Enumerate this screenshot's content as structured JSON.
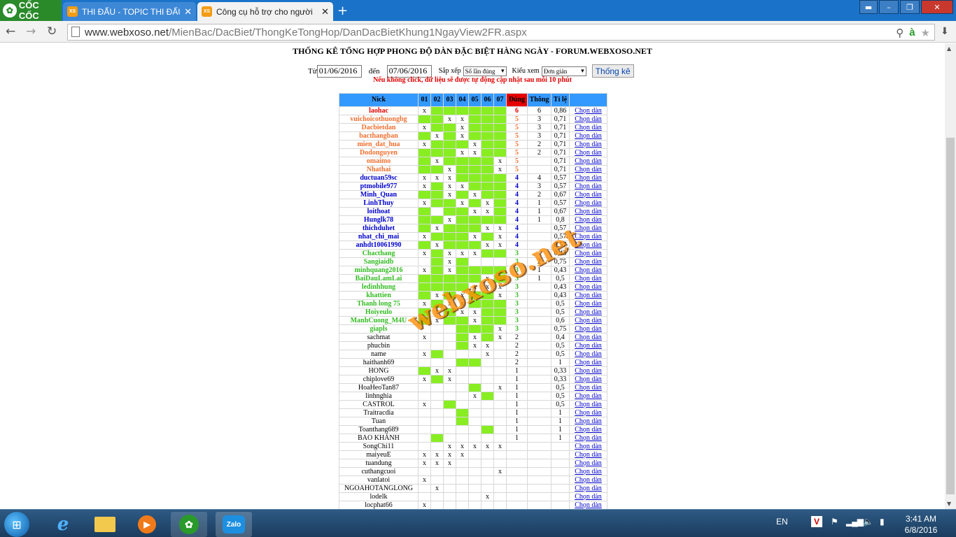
{
  "browser": {
    "logo": "CỐC CỐC",
    "tabs": [
      {
        "label": "THI ĐẤU - TOPIC THI ĐẤU",
        "icon": "XS"
      },
      {
        "label": "Công cụ hỗ trợ cho người",
        "icon": "XS"
      }
    ],
    "url_host": "www.webxoso.net",
    "url_path": "/MienBac/DacBiet/ThongKeTongHop/DanDacBietKhung1NgayView2FR.aspx"
  },
  "page": {
    "title": "THỐNG KÊ TỔNG HỢP PHONG ĐỘ DÀN ĐẶC BIỆT HÀNG NGÀY - FORUM.WEBXOSO.NET",
    "from_label": "Từ",
    "from_value": "01/06/2016",
    "to_label": "đến",
    "to_value": "07/06/2016",
    "sort_label": "Sắp xếp",
    "sort_value": "Số lần đúng",
    "view_label": "Kiểu xem",
    "view_value": "Đơn giản",
    "submit_label": "Thống kê",
    "note": "Nếu không click, dữ liệu sẽ được tự động cập nhật sau mỗi 10 phút",
    "watermark": "webxoso.net"
  },
  "table": {
    "headers": [
      "Nick",
      "01",
      "02",
      "03",
      "04",
      "05",
      "06",
      "07",
      "Đúng",
      "Thông",
      "Tỉ lệ",
      ""
    ],
    "link_text": "Chọn dàn",
    "colors": {
      "red": "#e00000",
      "orange": "#f07030",
      "blue": "#0000cc",
      "green": "#33bb22",
      "black": "#000000"
    },
    "rows": [
      {
        "nick": "laohac",
        "color": "red",
        "cells": [
          "x",
          "g",
          "g",
          "g",
          "g",
          "g",
          "g"
        ],
        "dung": "6",
        "thong": "6",
        "ratio": "0,86"
      },
      {
        "nick": "vuichoicothuongbg",
        "color": "orange",
        "cells": [
          "g",
          "g",
          "x",
          "x",
          "g",
          "g",
          "g"
        ],
        "dung": "5",
        "thong": "3",
        "ratio": "0,71"
      },
      {
        "nick": "Dacbietdan",
        "color": "orange",
        "cells": [
          "x",
          "g",
          "g",
          "x",
          "g",
          "g",
          "g"
        ],
        "dung": "5",
        "thong": "3",
        "ratio": "0,71"
      },
      {
        "nick": "bacthangban",
        "color": "orange",
        "cells": [
          "g",
          "x",
          "g",
          "x",
          "g",
          "g",
          "g"
        ],
        "dung": "5",
        "thong": "3",
        "ratio": "0,71"
      },
      {
        "nick": "mien_dat_hua",
        "color": "orange",
        "cells": [
          "x",
          "g",
          "g",
          "g",
          "x",
          "g",
          "g"
        ],
        "dung": "5",
        "thong": "2",
        "ratio": "0,71"
      },
      {
        "nick": "Dodonguyen",
        "color": "orange",
        "cells": [
          "g",
          "g",
          "g",
          "x",
          "x",
          "g",
          "g"
        ],
        "dung": "5",
        "thong": "2",
        "ratio": "0,71"
      },
      {
        "nick": "omaimo",
        "color": "orange",
        "cells": [
          "g",
          "x",
          "g",
          "g",
          "g",
          "g",
          "x"
        ],
        "dung": "5",
        "thong": "",
        "ratio": "0,71"
      },
      {
        "nick": "Nhathai",
        "color": "orange",
        "cells": [
          "g",
          "g",
          "x",
          "g",
          "g",
          "g",
          "x"
        ],
        "dung": "5",
        "thong": "",
        "ratio": "0,71"
      },
      {
        "nick": "ductuan59sc",
        "color": "blue",
        "cells": [
          "x",
          "x",
          "x",
          "g",
          "g",
          "g",
          "g"
        ],
        "dung": "4",
        "thong": "4",
        "ratio": "0,57"
      },
      {
        "nick": "ptmobile977",
        "color": "blue",
        "cells": [
          "x",
          "g",
          "x",
          "x",
          "g",
          "g",
          "g"
        ],
        "dung": "4",
        "thong": "3",
        "ratio": "0,57"
      },
      {
        "nick": "Minh_Quan",
        "color": "blue",
        "cells": [
          "g",
          "g",
          "x",
          "g",
          "x",
          "g",
          "g"
        ],
        "dung": "4",
        "thong": "2",
        "ratio": "0,67"
      },
      {
        "nick": "LinhThuy",
        "color": "blue",
        "cells": [
          "x",
          "g",
          "g",
          "x",
          "g",
          "x",
          "g"
        ],
        "dung": "4",
        "thong": "1",
        "ratio": "0,57"
      },
      {
        "nick": "loithoat",
        "color": "blue",
        "cells": [
          "g",
          "",
          "g",
          "g",
          "x",
          "x",
          "g"
        ],
        "dung": "4",
        "thong": "1",
        "ratio": "0,67"
      },
      {
        "nick": "Hunglk78",
        "color": "blue",
        "cells": [
          "g",
          "g",
          "x",
          "g",
          "g",
          "g",
          "g"
        ],
        "dung": "4",
        "thong": "1",
        "ratio": "0,8"
      },
      {
        "nick": "thichduhet",
        "color": "blue",
        "cells": [
          "g",
          "x",
          "g",
          "g",
          "g",
          "x",
          "x"
        ],
        "dung": "4",
        "thong": "",
        "ratio": "0,57"
      },
      {
        "nick": "nhat_chi_mai",
        "color": "blue",
        "cells": [
          "x",
          "g",
          "g",
          "g",
          "x",
          "g",
          "x"
        ],
        "dung": "4",
        "thong": "",
        "ratio": "0,57"
      },
      {
        "nick": "anhdt10061990",
        "color": "blue",
        "cells": [
          "g",
          "x",
          "g",
          "g",
          "g",
          "x",
          "x"
        ],
        "dung": "4",
        "thong": "",
        "ratio": "0,57"
      },
      {
        "nick": "Chacthang",
        "color": "green",
        "cells": [
          "x",
          "g",
          "x",
          "x",
          "x",
          "g",
          "g"
        ],
        "dung": "3",
        "thong": "",
        "ratio": "0,43"
      },
      {
        "nick": "Sangiaidb",
        "color": "green",
        "cells": [
          "",
          "g",
          "x",
          "g",
          "",
          "",
          ""
        ],
        "dung": "3",
        "thong": "2",
        "ratio": "0,75"
      },
      {
        "nick": "minhquang2016",
        "color": "green",
        "cells": [
          "x",
          "g",
          "x",
          "g",
          "g",
          "g",
          "g"
        ],
        "dung": "3",
        "thong": "1",
        "ratio": "0,43"
      },
      {
        "nick": "BaiDauLamLai",
        "color": "green",
        "cells": [
          "g",
          "g",
          "g",
          "g",
          "g",
          "x",
          "g"
        ],
        "dung": "3",
        "thong": "1",
        "ratio": "0,5"
      },
      {
        "nick": "ledinhhung",
        "color": "green",
        "cells": [
          "g",
          "g",
          "g",
          "g",
          "x",
          "x",
          "x"
        ],
        "dung": "3",
        "thong": "",
        "ratio": "0,43"
      },
      {
        "nick": "khattien",
        "color": "green",
        "cells": [
          "g",
          "x",
          "g",
          "x",
          "g",
          "g",
          "x"
        ],
        "dung": "3",
        "thong": "",
        "ratio": "0,43"
      },
      {
        "nick": "Thanh long 75",
        "color": "green",
        "cells": [
          "x",
          "g",
          "x",
          "x",
          "g",
          "g",
          "g"
        ],
        "dung": "3",
        "thong": "",
        "ratio": "0,5"
      },
      {
        "nick": "Hoiyeulo",
        "color": "green",
        "cells": [
          "g",
          "x",
          "g",
          "x",
          "x",
          "g",
          "g"
        ],
        "dung": "3",
        "thong": "",
        "ratio": "0,5"
      },
      {
        "nick": "ManhCuong_M4U",
        "color": "green",
        "cells": [
          "g",
          "x",
          "g",
          "g",
          "x",
          "g",
          "g"
        ],
        "dung": "3",
        "thong": "",
        "ratio": "0,6"
      },
      {
        "nick": "giapls",
        "color": "green",
        "cells": [
          "",
          "",
          "",
          "g",
          "g",
          "g",
          "x"
        ],
        "dung": "3",
        "thong": "",
        "ratio": "0,75"
      },
      {
        "nick": "sachmat",
        "color": "black",
        "cells": [
          "x",
          "",
          "",
          "g",
          "x",
          "g",
          "x"
        ],
        "dung": "2",
        "thong": "",
        "ratio": "0,4"
      },
      {
        "nick": "phucbin",
        "color": "black",
        "cells": [
          "",
          "",
          "",
          "g",
          "x",
          "x",
          ""
        ],
        "dung": "2",
        "thong": "",
        "ratio": "0,5"
      },
      {
        "nick": "name",
        "color": "black",
        "cells": [
          "x",
          "g",
          "",
          "",
          "",
          "x",
          ""
        ],
        "dung": "2",
        "thong": "",
        "ratio": "0,5"
      },
      {
        "nick": "haithanh69",
        "color": "black",
        "cells": [
          "",
          "",
          "",
          "g",
          "g",
          "",
          ""
        ],
        "dung": "2",
        "thong": "",
        "ratio": "1"
      },
      {
        "nick": "HONG",
        "color": "black",
        "cells": [
          "g",
          "x",
          "x",
          "",
          "",
          "",
          ""
        ],
        "dung": "1",
        "thong": "",
        "ratio": "0,33"
      },
      {
        "nick": "chiplove69",
        "color": "black",
        "cells": [
          "x",
          "g",
          "x",
          "",
          "",
          "",
          ""
        ],
        "dung": "1",
        "thong": "",
        "ratio": "0,33"
      },
      {
        "nick": "HoaHeoTan87",
        "color": "black",
        "cells": [
          "",
          "",
          "",
          "",
          "g",
          "",
          "x"
        ],
        "dung": "1",
        "thong": "",
        "ratio": "0,5"
      },
      {
        "nick": "linhnghia",
        "color": "black",
        "cells": [
          "",
          "",
          "",
          "",
          "x",
          "g",
          ""
        ],
        "dung": "1",
        "thong": "",
        "ratio": "0,5"
      },
      {
        "nick": "CASTROL",
        "color": "black",
        "cells": [
          "x",
          "",
          "g",
          "",
          "",
          "",
          ""
        ],
        "dung": "1",
        "thong": "",
        "ratio": "0,5"
      },
      {
        "nick": "Traitracdia",
        "color": "black",
        "cells": [
          "",
          "",
          "",
          "g",
          "",
          "",
          ""
        ],
        "dung": "1",
        "thong": "",
        "ratio": "1"
      },
      {
        "nick": "Tuan",
        "color": "black",
        "cells": [
          "",
          "",
          "",
          "g",
          "",
          "",
          ""
        ],
        "dung": "1",
        "thong": "",
        "ratio": "1"
      },
      {
        "nick": "Toanthang689",
        "color": "black",
        "cells": [
          "",
          "",
          "",
          "",
          "",
          "g",
          ""
        ],
        "dung": "1",
        "thong": "",
        "ratio": "1"
      },
      {
        "nick": "BAO KHÁNH",
        "color": "black",
        "cells": [
          "",
          "g",
          "",
          "",
          "",
          "",
          ""
        ],
        "dung": "1",
        "thong": "",
        "ratio": "1"
      },
      {
        "nick": "SongChi11",
        "color": "black",
        "cells": [
          "",
          "",
          "x",
          "x",
          "x",
          "x",
          "x"
        ],
        "dung": "",
        "thong": "",
        "ratio": ""
      },
      {
        "nick": "maiyeuE",
        "color": "black",
        "cells": [
          "x",
          "x",
          "x",
          "x",
          "",
          "",
          ""
        ],
        "dung": "",
        "thong": "",
        "ratio": ""
      },
      {
        "nick": "tuandung",
        "color": "black",
        "cells": [
          "x",
          "x",
          "x",
          "",
          "",
          "",
          ""
        ],
        "dung": "",
        "thong": "",
        "ratio": ""
      },
      {
        "nick": "cuthangcuoi",
        "color": "black",
        "cells": [
          "",
          "",
          "",
          "",
          "",
          "",
          "x"
        ],
        "dung": "",
        "thong": "",
        "ratio": ""
      },
      {
        "nick": "vanlatoi",
        "color": "black",
        "cells": [
          "x",
          "",
          "",
          "",
          "",
          "",
          ""
        ],
        "dung": "",
        "thong": "",
        "ratio": ""
      },
      {
        "nick": "NGOAHOTANGLONG",
        "color": "black",
        "cells": [
          "",
          "x",
          "",
          "",
          "",
          "",
          ""
        ],
        "dung": "",
        "thong": "",
        "ratio": ""
      },
      {
        "nick": "lodelk",
        "color": "black",
        "cells": [
          "",
          "",
          "",
          "",
          "",
          "x",
          ""
        ],
        "dung": "",
        "thong": "",
        "ratio": ""
      },
      {
        "nick": "locphat66",
        "color": "black",
        "cells": [
          "x",
          "",
          "",
          "",
          "",
          "",
          ""
        ],
        "dung": "",
        "thong": "",
        "ratio": ""
      }
    ]
  },
  "taskbar": {
    "lang": "EN",
    "time": "3:41 AM",
    "date": "6/8/2016",
    "zalo_label": "Zalo"
  }
}
